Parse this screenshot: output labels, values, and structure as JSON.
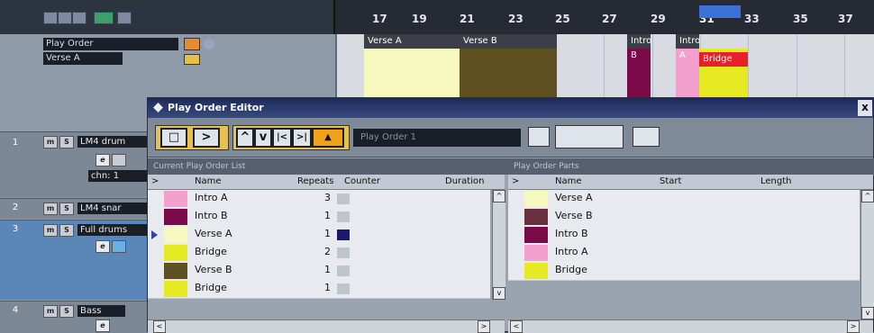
{
  "ruler": {
    "numbers": [
      "17",
      "19",
      "21",
      "23",
      "25",
      "27",
      "29",
      "31",
      "33",
      "35",
      "37"
    ]
  },
  "tracks_list": {
    "play_order_select": "Play Order",
    "verse_field": "Verse A"
  },
  "arrange_parts": [
    {
      "label": "Verse A",
      "color": "#f7f7c0"
    },
    {
      "label": "Verse B",
      "color": "#5e5020"
    },
    {
      "label": "Intro B",
      "color": "#7a0a4a"
    },
    {
      "label": "Intro A",
      "color": "#f3a0cf"
    },
    {
      "label": "Bridge",
      "color": "#e6ea22",
      "tag_color": "#e8202a"
    }
  ],
  "tracks": [
    {
      "number": "1",
      "mute": "m",
      "solo": "S",
      "name": "LM4 drum",
      "channel": "chn: 1"
    },
    {
      "number": "2",
      "mute": "m",
      "solo": "S",
      "name": "LM4 snar"
    },
    {
      "number": "3",
      "mute": "m",
      "solo": "S",
      "name": "Full drums"
    },
    {
      "number": "4",
      "mute": "m",
      "solo": "S",
      "name": "Bass"
    }
  ],
  "editor": {
    "title": "Play Order Editor",
    "close_glyph": "x",
    "play_order_name": "Play Order 1",
    "left_pane_header": "Current Play Order List",
    "right_pane_header": "Play Order Parts",
    "left_columns": {
      "name": "Name",
      "repeats": "Repeats",
      "counter": "Counter",
      "duration": "Duration"
    },
    "right_columns": {
      "name": "Name",
      "start": "Start",
      "length": "Length"
    },
    "toolbar": {
      "stop": "□",
      "play": ">",
      "up": "^",
      "down": "v",
      "prev": "|<",
      "next": ">|",
      "loop": "▲"
    },
    "order_list": [
      {
        "name": "Intro A",
        "repeats": "3",
        "color": "#f3a0cf",
        "counter_color": "#c0c4cc"
      },
      {
        "name": "Intro B",
        "repeats": "1",
        "color": "#7a0a4a",
        "counter_color": "#c0c4cc"
      },
      {
        "name": "Verse A",
        "repeats": "1",
        "color": "#f7f7c0",
        "counter_color": "#1a1a6a",
        "current": true
      },
      {
        "name": "Bridge",
        "repeats": "2",
        "color": "#e6ea22",
        "counter_color": "#c0c4cc"
      },
      {
        "name": "Verse B",
        "repeats": "1",
        "color": "#5e5020",
        "counter_color": "#c0c4cc"
      },
      {
        "name": "Bridge",
        "repeats": "1",
        "color": "#e6ea22",
        "counter_color": "#c0c4cc"
      }
    ],
    "parts_list": [
      {
        "name": "Verse A",
        "color": "#f7f7c0"
      },
      {
        "name": "Verse B",
        "color": "#6a3040"
      },
      {
        "name": "Intro B",
        "color": "#7a0a4a"
      },
      {
        "name": "Intro A",
        "color": "#f3a0cf"
      },
      {
        "name": "Bridge",
        "color": "#e6ea22"
      }
    ]
  }
}
